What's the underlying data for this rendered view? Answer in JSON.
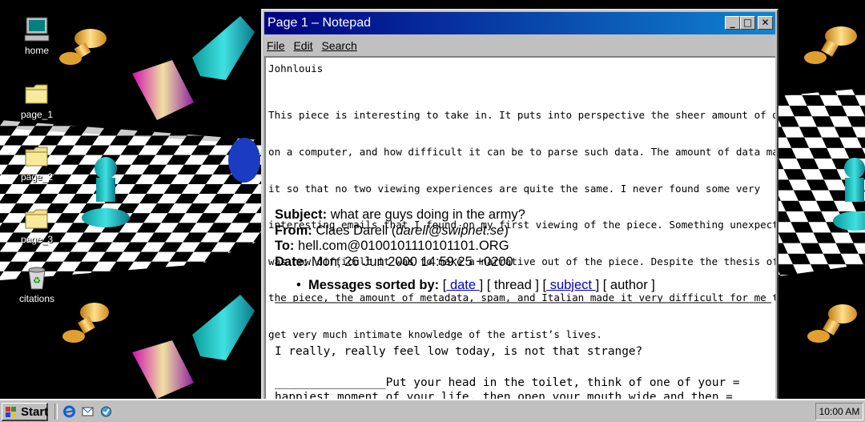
{
  "desktop": {
    "icons": [
      {
        "label": "home",
        "icon": "computer-icon"
      },
      {
        "label": "page_1",
        "icon": "folder-icon"
      },
      {
        "label": "page_2",
        "icon": "folder-icon"
      },
      {
        "label": "page_3",
        "icon": "folder-icon"
      },
      {
        "label": "citations",
        "icon": "recycle-bin-icon"
      }
    ]
  },
  "window": {
    "title": "Page 1 – Notepad",
    "controls": {
      "minimize": "_",
      "maximize": "□",
      "close": "✕"
    },
    "menu": [
      "File",
      "Edit",
      "Search"
    ]
  },
  "document": {
    "author": "Johnlouis",
    "paragraph": [
      "This piece is interesting to take in. It puts into perspective the sheer amount of data",
      "on a computer, and how difficult it can be to parse such data. The amount of data makes",
      "it so that no two viewing experiences are quite the same. I never found some very",
      "interesting emails that I found on my first viewing of the piece. Something unexpected",
      "was how difficult it was to make a narrative out of the piece. Despite the thesis of",
      "the piece, the amount of metadata, spam, and Italian made it very difficult for me to",
      "get very much intimate knowledge of the artist’s lives."
    ],
    "email": {
      "subject_label": "Subject:",
      "subject": "what are guys doing in the army?",
      "from_label": "From:",
      "from_name": "Claes Darell (",
      "from_email": "darell@swipnet.se",
      "from_close": ")",
      "to_label": "To:",
      "to": "hell.com@0100101110101101.ORG",
      "date_label": "Date:",
      "date": "Mon, 26 Jun 2000 14:59:25 +0200",
      "sorted_label": "Messages sorted by:",
      "sort_date": " date ",
      "sort_thread": "[ thread ]",
      "sort_subject": " subject ",
      "sort_author": "[ author ]",
      "body_line1": "I really, really feel low today, is not that strange?",
      "body_line2": "________________Put your head in the toilet, think of one of your =",
      "body_line3": "happiest moment of your life, then open your mouth wide and then ="
    }
  },
  "taskbar": {
    "start_label": "Start",
    "quick_launch": [
      "internet-explorer-icon",
      "outlook-express-icon",
      "channels-icon"
    ],
    "clock": "10:00 AM"
  }
}
